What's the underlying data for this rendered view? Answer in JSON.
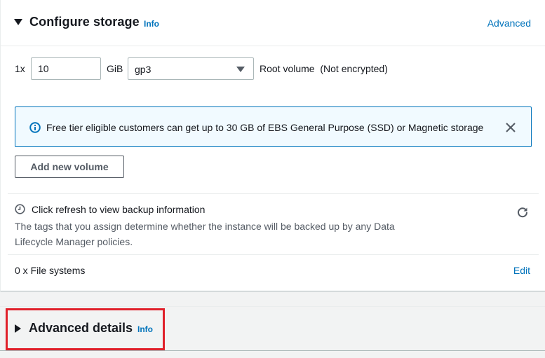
{
  "storage": {
    "title": "Configure storage",
    "info_label": "Info",
    "advanced_label": "Advanced",
    "volume": {
      "count": "1x",
      "size_value": "10",
      "unit": "GiB",
      "type_value": "gp3",
      "root_label": "Root volume  (Not encrypted)"
    },
    "banner": {
      "icon": "info-circle-icon",
      "text": "Free tier eligible customers can get up to 30 GB of EBS General Purpose (SSD) or Magnetic storage",
      "accent_color": "#0073bb"
    },
    "add_volume_label": "Add new volume",
    "backup": {
      "title": "Click refresh to view backup information",
      "description": "The tags that you assign determine whether the instance will be backed up by any Data Lifecycle Manager policies."
    },
    "file_systems": {
      "label": "0 x File systems",
      "edit_label": "Edit"
    }
  },
  "advanced_details": {
    "title": "Advanced details",
    "info_label": "Info",
    "highlight_color": "#e0202a"
  }
}
